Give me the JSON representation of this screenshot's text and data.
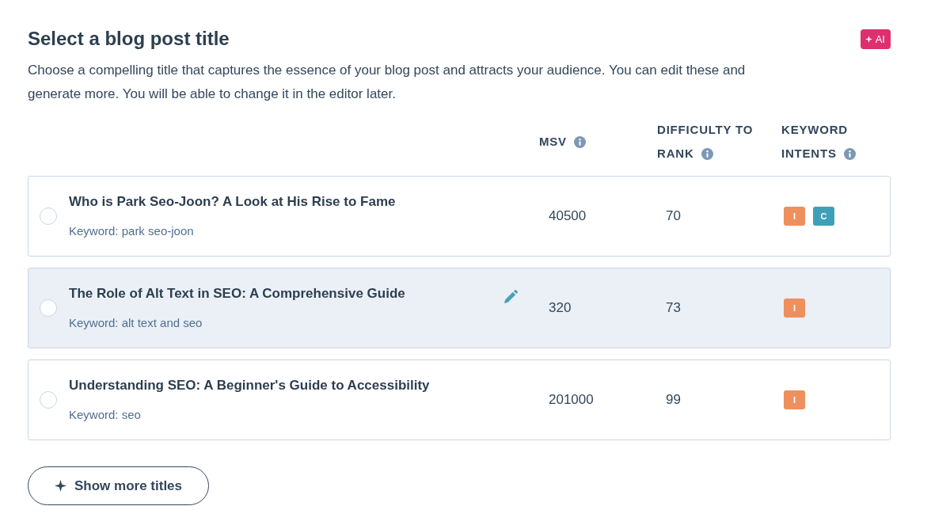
{
  "header": {
    "title": "Select a blog post title",
    "ai_badge": "AI",
    "description": "Choose a compelling title that captures the essence of your blog post and attracts your audience. You can edit these and generate more. You will be able to change it in the editor later."
  },
  "table": {
    "columns": [
      {
        "label_lines": [
          "MSV"
        ]
      },
      {
        "label_lines": [
          "DIFFICULTY TO",
          "RANK"
        ]
      },
      {
        "label_lines": [
          "KEYWORD",
          "INTENTS"
        ]
      }
    ],
    "rows": [
      {
        "title": "Who is Park Seo-Joon? A Look at His Rise to Fame",
        "keyword": "Keyword: park seo-joon",
        "msv": "40500",
        "difficulty": "70",
        "intents": [
          {
            "label": "I",
            "color": "#ee8f5e"
          },
          {
            "label": "C",
            "color": "#3f9fb6"
          }
        ],
        "selected": false,
        "hovered": false
      },
      {
        "title": "The Role of Alt Text in SEO: A Comprehensive Guide",
        "keyword": "Keyword: alt text and seo",
        "msv": "320",
        "difficulty": "73",
        "intents": [
          {
            "label": "I",
            "color": "#ee8f5e"
          }
        ],
        "selected": false,
        "hovered": true
      },
      {
        "title": "Understanding SEO: A Beginner's Guide to Accessibility",
        "keyword": "Keyword: seo",
        "msv": "201000",
        "difficulty": "99",
        "intents": [
          {
            "label": "I",
            "color": "#ee8f5e"
          }
        ],
        "selected": false,
        "hovered": false
      }
    ]
  },
  "more_button": {
    "label": "Show more titles"
  }
}
